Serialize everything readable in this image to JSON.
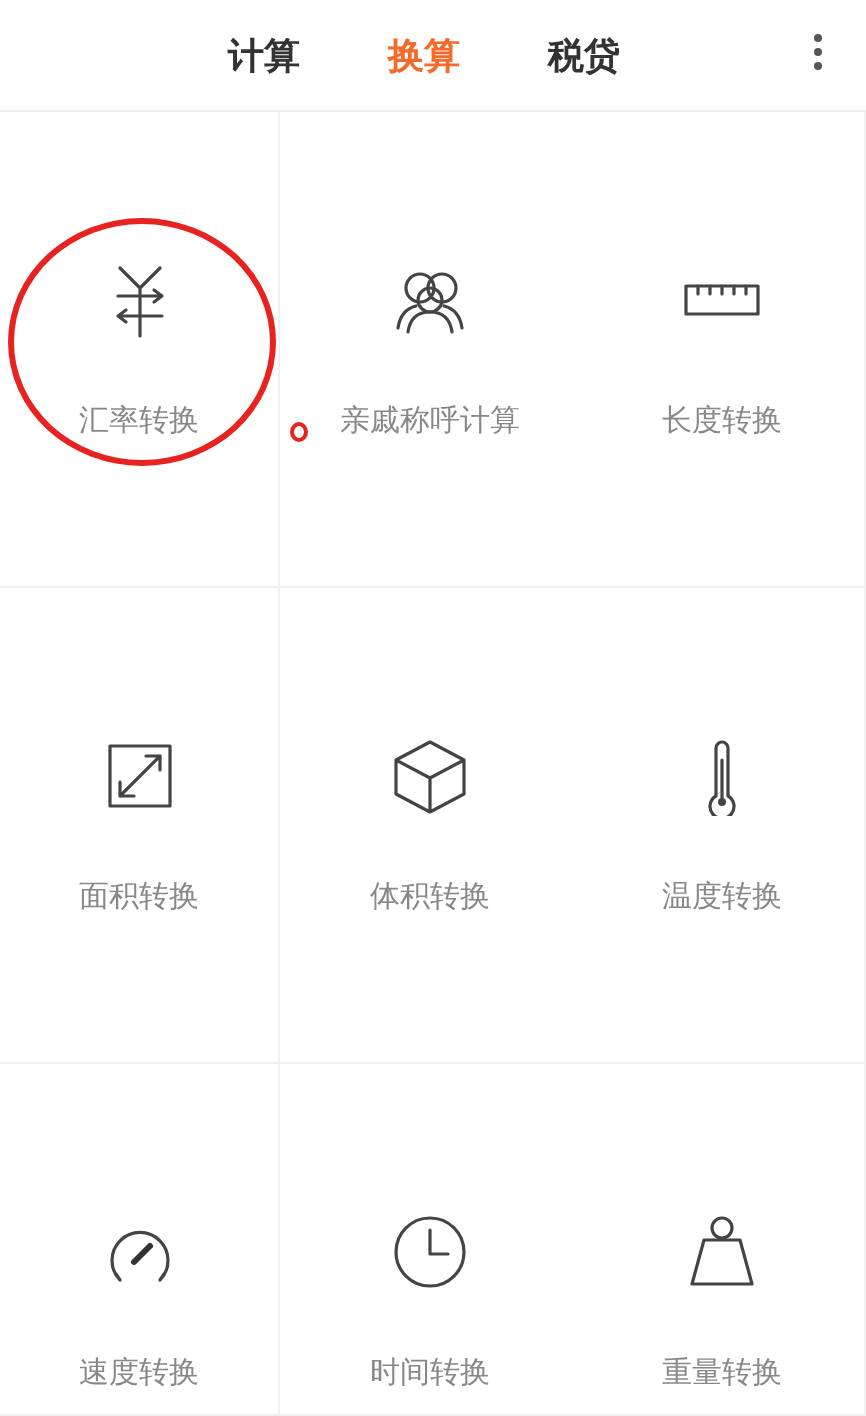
{
  "tabs": [
    {
      "label": "计算",
      "selected": false
    },
    {
      "label": "换算",
      "selected": true
    },
    {
      "label": "税贷",
      "selected": false
    }
  ],
  "items": [
    {
      "kind": "currency",
      "label": "汇率转换",
      "circled": true,
      "dotted": false
    },
    {
      "kind": "people",
      "label": "亲戚称呼计算",
      "circled": false,
      "dotted": true
    },
    {
      "kind": "ruler",
      "label": "长度转换",
      "circled": false,
      "dotted": false
    },
    {
      "kind": "area",
      "label": "面积转换",
      "circled": false,
      "dotted": false
    },
    {
      "kind": "cube",
      "label": "体积转换",
      "circled": false,
      "dotted": false
    },
    {
      "kind": "thermometer",
      "label": "温度转换",
      "circled": false,
      "dotted": false
    },
    {
      "kind": "gauge",
      "label": "速度转换",
      "circled": false,
      "dotted": false
    },
    {
      "kind": "clock",
      "label": "时间转换",
      "circled": false,
      "dotted": false
    },
    {
      "kind": "weight",
      "label": "重量转换",
      "circled": false,
      "dotted": false
    }
  ]
}
